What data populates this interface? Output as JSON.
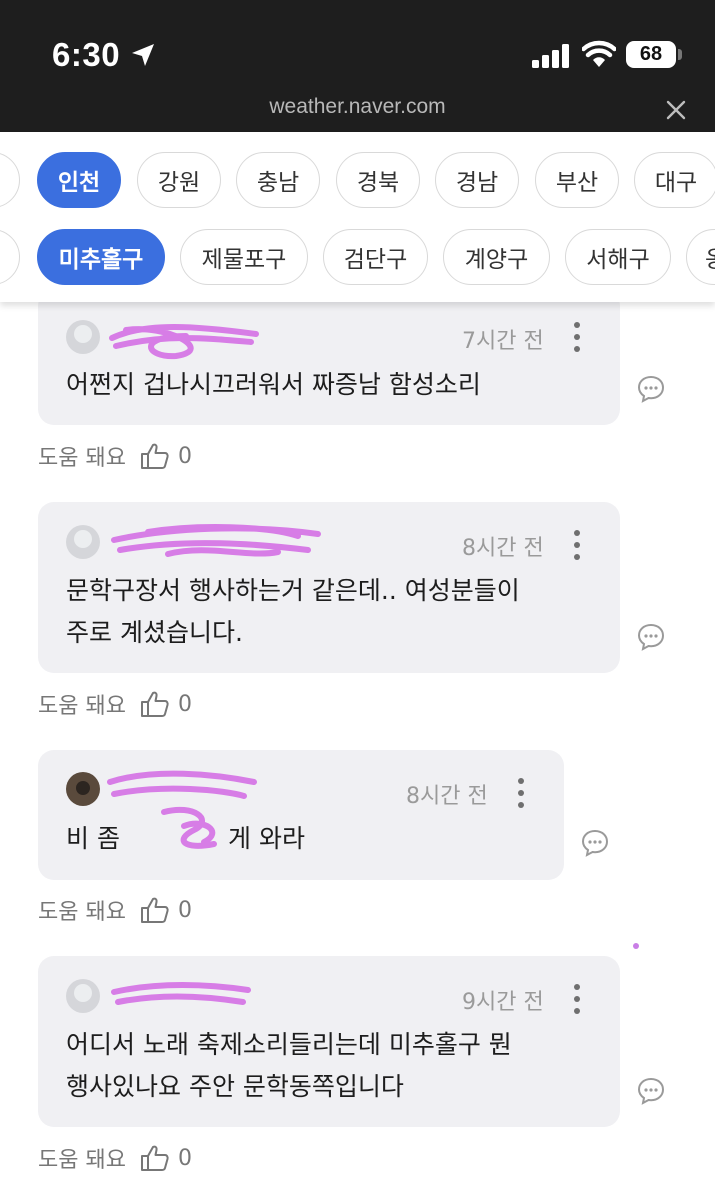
{
  "status_bar": {
    "time": "6:30",
    "battery": "68"
  },
  "browser": {
    "url": "weather.naver.com"
  },
  "region_chips": {
    "provinces": [
      "",
      "인천",
      "강원",
      "충남",
      "경북",
      "경남",
      "부산",
      "대구"
    ],
    "provinces_active": "인천",
    "districts": [
      "",
      "미추홀구",
      "제물포구",
      "검단구",
      "계양구",
      "서해구",
      "옹"
    ],
    "districts_active": "미추홀구"
  },
  "comments": [
    {
      "time": "7시간 전",
      "text": [
        "어쩐지 겁나시끄러워서 짜증남 함성소리"
      ],
      "helpful_label": "도움 돼요",
      "likes": "0"
    },
    {
      "time": "8시간 전",
      "text": [
        "문학구장서 행사하는거 같은데.. 여성분들이",
        "주로 계셨습니다."
      ],
      "helpful_label": "도움 돼요",
      "likes": "0"
    },
    {
      "time": "8시간 전",
      "text": [
        "비 좀 ",
        "게 와라"
      ],
      "helpful_label": "도움 돼요",
      "likes": "0"
    },
    {
      "time": "9시간 전",
      "text": [
        "어디서 노래 축제소리들리는데 미추홀구 뭔",
        "행사있나요 주안 문학동쪽입니다"
      ],
      "helpful_label": "도움 돼요",
      "likes": "0"
    }
  ],
  "colors": {
    "accent": "#3b6fdf",
    "bubble": "#f0f0f3",
    "scribble": "#d77de6"
  }
}
